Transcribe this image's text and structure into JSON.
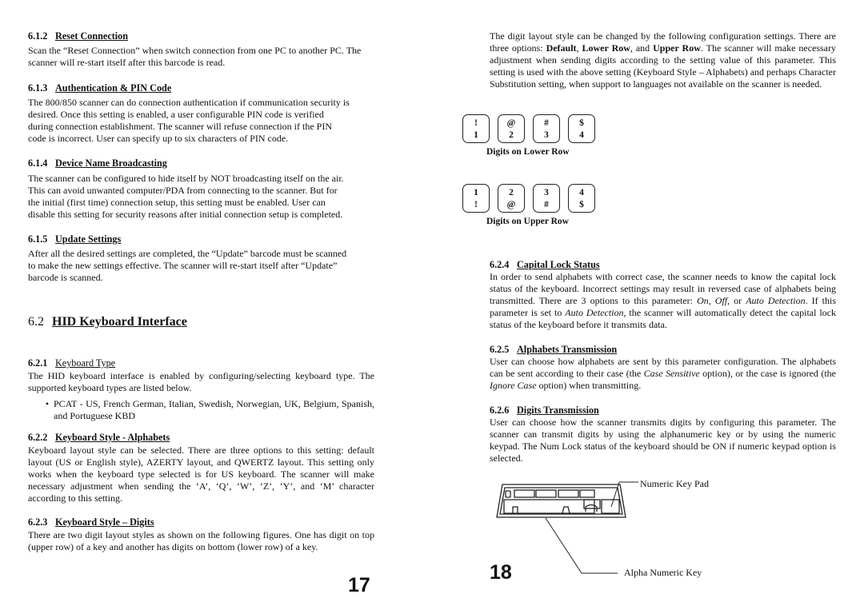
{
  "left_page": {
    "sections": [
      {
        "number": "6.1.2",
        "title": "Reset Connection",
        "body": "Scan the “Reset Connection” when switch connection from one PC to another PC. The scanner will re-start itself after this barcode is read."
      },
      {
        "number": "6.1.3",
        "title": "Authentication & PIN Code",
        "body_lines": [
          "The 800/850 scanner can do connection authentication if communication security is",
          "desired. Once this setting is enabled, a user configurable PIN code is verified",
          "during connection establishment. The scanner will refuse connection if the PIN",
          "code is incorrect. User can specify up to six characters of PIN code."
        ]
      },
      {
        "number": "6.1.4",
        "title": "Device Name Broadcasting",
        "body_lines": [
          "The scanner can be configured to hide itself by NOT broadcasting itself on the air.",
          "This can avoid unwanted computer/PDA from connecting to the scanner. But for",
          "the initial (first time) connection setup, this setting must be enabled. User can",
          "disable this setting for security reasons after initial connection setup is completed."
        ]
      },
      {
        "number": "6.1.5",
        "title": "Update Settings",
        "body_lines": [
          "After all the desired settings are completed, the “Update” barcode must be scanned",
          "to make the new settings effective. The scanner will re-start itself after “Update”",
          "barcode is scanned."
        ]
      }
    ],
    "chapter": {
      "number": "6.2",
      "title": "HID Keyboard Interface"
    },
    "subsections": [
      {
        "number": "6.2.1",
        "title": "Keyboard Type",
        "body": "The HID keyboard interface is enabled by configuring/selecting keyboard type. The supported keyboard types are listed below.",
        "bullets": [
          "PCAT - US, French German, Italian, Swedish, Norwegian, UK, Belgium, Spanish, and Portuguese KBD"
        ]
      },
      {
        "number": "6.2.2",
        "title": "Keyboard Style - Alphabets",
        "body": "Keyboard layout style can be selected. There are three options to this setting: default layout (US or English style), AZERTY layout, and QWERTZ layout. This setting only works when the keyboard type selected is for US keyboard. The scanner will make necessary adjustment when sending the ‘A’, ‘Q’, ‘W’, ‘Z’,  ‘Y’, and ‘M’ character according to this setting."
      },
      {
        "number": "6.2.3",
        "title": "Keyboard Style – Digits",
        "body": "There are two digit layout styles as shown on the following figures. One has digit on top (upper row) of a key and another has digits on bottom (lower row) of a key."
      }
    ],
    "page_number": "17"
  },
  "right_page": {
    "intro": {
      "before": "The digit layout style can be changed by the following configuration settings. There are three options: ",
      "opt1": "Default",
      "sep1": ", ",
      "opt2": "Lower Row",
      "sep2": ", and ",
      "opt3": "Upper Row",
      "after": ". The scanner will make necessary adjustment when sending digits according to the setting value of this parameter. This setting is used with the above setting (Keyboard Style – Alphabets) and perhaps Character Substitution setting, when support to languages not available on the scanner is needed."
    },
    "figures": [
      {
        "caption": "Digits on Lower Row",
        "keys": [
          {
            "top": "!",
            "bottom": "1"
          },
          {
            "top": "@",
            "bottom": "2"
          },
          {
            "top": "#",
            "bottom": "3"
          },
          {
            "top": "$",
            "bottom": "4"
          }
        ]
      },
      {
        "caption": "Digits on Upper Row",
        "keys": [
          {
            "top": "1",
            "bottom": "!"
          },
          {
            "top": "2",
            "bottom": "@"
          },
          {
            "top": "3",
            "bottom": "#"
          },
          {
            "top": "4",
            "bottom": "$"
          }
        ]
      }
    ],
    "sections": [
      {
        "number": "6.2.4",
        "title": "Capital Lock Status",
        "b1": "In order to send alphabets with correct case, the scanner needs to know the capital lock status of the keyboard. Incorrect settings may result in reversed case of alphabets being transmitted. There are 3 options to this parameter: ",
        "i1": "On",
        "b2": ", ",
        "i2": "Off",
        "b3": ", or ",
        "i3": "Auto Detection",
        "b4": ". If this parameter is set to ",
        "i4": "Auto Detection",
        "b5": ", the scanner will automatically detect the capital lock status of the keyboard before it transmits data."
      },
      {
        "number": "6.2.5",
        "title": "Alphabets Transmission",
        "b1": "User can choose how alphabets are sent by this parameter configuration. The alphabets can be sent according to their case (the ",
        "i1": "Case Sensitive",
        "b2": " option), or the case is ignored (the ",
        "i2": "Ignore Case",
        "b3": " option) when transmitting."
      },
      {
        "number": "6.2.6",
        "title": "Digits Transmission",
        "body": "User can choose how the scanner transmits digits by configuring this parameter. The scanner can transmit digits by using the alphanumeric key or by using the numeric keypad. The Num Lock status of the keyboard should be ON if numeric keypad option is selected."
      }
    ],
    "keyboard_figure": {
      "label_keypad": "Numeric Key Pad",
      "label_alpha": "Alpha Numeric Key"
    },
    "page_number": "18"
  }
}
